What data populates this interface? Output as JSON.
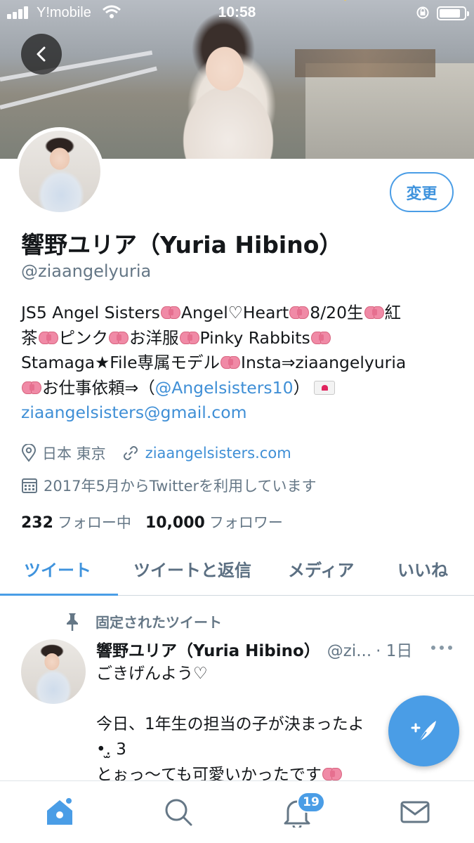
{
  "status_bar": {
    "carrier": "Y!mobile",
    "time": "10:58",
    "battery_level": 0.85
  },
  "profile": {
    "display_name": "響野ユリア（Yuria Hibino）",
    "handle": "@ziaangelyuria",
    "edit_button_label": "変更",
    "bio_lines": [
      [
        "JS5 Angel Sisters",
        "Angel♡Heart",
        "8/20生",
        "紅"
      ],
      [
        "茶",
        "ピンク",
        "お洋服",
        "Pinky Rabbits",
        ""
      ],
      [
        "Stamaga★File専属モデル",
        "Insta⇒ziaangelyuria"
      ],
      [
        "",
        "お仕事依頼⇒（",
        "@Angelsisters10",
        "）"
      ]
    ],
    "bio_email": "ziaangelsisters@gmail.com",
    "location": "日本 東京",
    "website": "ziaangelsisters.com",
    "joined": "2017年5月からTwitterを利用しています",
    "following_count": "232",
    "following_label": "フォロー中",
    "followers_count": "10,000",
    "followers_label": "フォロワー"
  },
  "tabs": [
    {
      "label": "ツイート",
      "active": true
    },
    {
      "label": "ツイートと返信",
      "active": false
    },
    {
      "label": "メディア",
      "active": false
    },
    {
      "label": "いいね",
      "active": false
    }
  ],
  "pinned_tweet": {
    "pinned_label": "固定されたツイート",
    "author_name": "響野ユリア（Yuria Hibino）",
    "author_handle": "@zi...",
    "date": "· 1日",
    "lines": [
      "ごきげんよう♡",
      "",
      "今日、1年生の担当の子が決まったよ",
      "•.̫ 3",
      "とぉっ〜ても可愛いかったです"
    ]
  },
  "bottom_nav": {
    "items": [
      "home-icon",
      "search-icon",
      "notifications-icon",
      "messages-icon"
    ],
    "notification_badge": "19"
  },
  "colors": {
    "accent": "#4a9de6",
    "link": "#3f8fd6",
    "secondary_text": "#657786"
  }
}
